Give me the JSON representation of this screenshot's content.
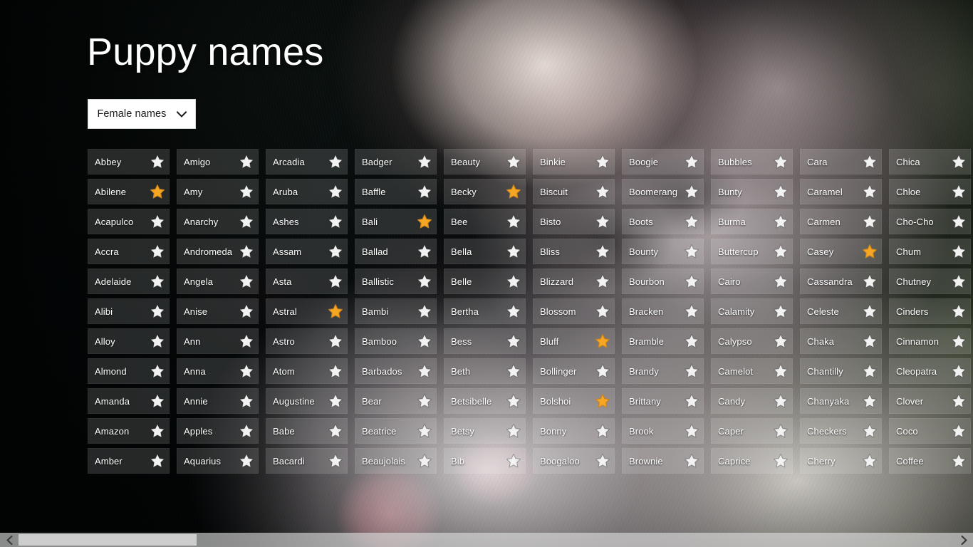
{
  "app": {
    "title": "Puppy names"
  },
  "filter": {
    "label": "Female names",
    "icon": "chevron-down-icon"
  },
  "scrollbar": {
    "left_arrow_icon": "chevron-left-icon",
    "right_arrow_icon": "chevron-right-icon",
    "thumb_position_percent": 0,
    "thumb_width_percent": 19
  },
  "colors": {
    "star_filled": "#f5a623",
    "star_empty": "#f2f2f2",
    "tile_overlay": "rgba(255,255,255,0.14)",
    "button_background": "#ffffff",
    "button_text": "#1b1b1b",
    "title_text": "#ffffff"
  },
  "grid": {
    "columns": [
      {
        "index": 0,
        "items": [
          {
            "name": "Abbey",
            "favorite": false
          },
          {
            "name": "Abilene",
            "favorite": true
          },
          {
            "name": "Acapulco",
            "favorite": false
          },
          {
            "name": "Accra",
            "favorite": false
          },
          {
            "name": "Adelaide",
            "favorite": false
          },
          {
            "name": "Alibi",
            "favorite": false
          },
          {
            "name": "Alloy",
            "favorite": false
          },
          {
            "name": "Almond",
            "favorite": false
          },
          {
            "name": "Amanda",
            "favorite": false
          },
          {
            "name": "Amazon",
            "favorite": false
          },
          {
            "name": "Amber",
            "favorite": false
          }
        ]
      },
      {
        "index": 1,
        "items": [
          {
            "name": "Amigo",
            "favorite": false
          },
          {
            "name": "Amy",
            "favorite": false
          },
          {
            "name": "Anarchy",
            "favorite": false
          },
          {
            "name": "Andromeda",
            "favorite": false
          },
          {
            "name": "Angela",
            "favorite": false
          },
          {
            "name": "Anise",
            "favorite": false
          },
          {
            "name": "Ann",
            "favorite": false
          },
          {
            "name": "Anna",
            "favorite": false
          },
          {
            "name": "Annie",
            "favorite": false
          },
          {
            "name": "Apples",
            "favorite": false
          },
          {
            "name": "Aquarius",
            "favorite": false
          }
        ]
      },
      {
        "index": 2,
        "items": [
          {
            "name": "Arcadia",
            "favorite": false
          },
          {
            "name": "Aruba",
            "favorite": false
          },
          {
            "name": "Ashes",
            "favorite": false
          },
          {
            "name": "Assam",
            "favorite": false
          },
          {
            "name": "Asta",
            "favorite": false
          },
          {
            "name": "Astral",
            "favorite": true
          },
          {
            "name": "Astro",
            "favorite": false
          },
          {
            "name": "Atom",
            "favorite": false
          },
          {
            "name": "Augustine",
            "favorite": false
          },
          {
            "name": "Babe",
            "favorite": false
          },
          {
            "name": "Bacardi",
            "favorite": false
          }
        ]
      },
      {
        "index": 3,
        "items": [
          {
            "name": "Badger",
            "favorite": false
          },
          {
            "name": "Baffle",
            "favorite": false
          },
          {
            "name": "Bali",
            "favorite": true
          },
          {
            "name": "Ballad",
            "favorite": false
          },
          {
            "name": "Ballistic",
            "favorite": false
          },
          {
            "name": "Bambi",
            "favorite": false
          },
          {
            "name": "Bamboo",
            "favorite": false
          },
          {
            "name": "Barbados",
            "favorite": false
          },
          {
            "name": "Bear",
            "favorite": false
          },
          {
            "name": "Beatrice",
            "favorite": false
          },
          {
            "name": "Beaujolais",
            "favorite": false
          }
        ]
      },
      {
        "index": 4,
        "items": [
          {
            "name": "Beauty",
            "favorite": false
          },
          {
            "name": "Becky",
            "favorite": true
          },
          {
            "name": "Bee",
            "favorite": false
          },
          {
            "name": "Bella",
            "favorite": false
          },
          {
            "name": "Belle",
            "favorite": false
          },
          {
            "name": "Bertha",
            "favorite": false
          },
          {
            "name": "Bess",
            "favorite": false
          },
          {
            "name": "Beth",
            "favorite": false
          },
          {
            "name": "Betsibelle",
            "favorite": false
          },
          {
            "name": "Betsy",
            "favorite": false
          },
          {
            "name": "Bib",
            "favorite": false
          }
        ]
      },
      {
        "index": 5,
        "items": [
          {
            "name": "Binkie",
            "favorite": false
          },
          {
            "name": "Biscuit",
            "favorite": false
          },
          {
            "name": "Bisto",
            "favorite": false
          },
          {
            "name": "Bliss",
            "favorite": false
          },
          {
            "name": "Blizzard",
            "favorite": false
          },
          {
            "name": "Blossom",
            "favorite": false
          },
          {
            "name": "Bluff",
            "favorite": true
          },
          {
            "name": "Bollinger",
            "favorite": false
          },
          {
            "name": "Bolshoi",
            "favorite": true
          },
          {
            "name": "Bonny",
            "favorite": false
          },
          {
            "name": "Boogaloo",
            "favorite": false
          }
        ]
      },
      {
        "index": 6,
        "items": [
          {
            "name": "Boogie",
            "favorite": false
          },
          {
            "name": "Boomerang",
            "favorite": false
          },
          {
            "name": "Boots",
            "favorite": false
          },
          {
            "name": "Bounty",
            "favorite": false
          },
          {
            "name": "Bourbon",
            "favorite": false
          },
          {
            "name": "Bracken",
            "favorite": false
          },
          {
            "name": "Bramble",
            "favorite": false
          },
          {
            "name": "Brandy",
            "favorite": false
          },
          {
            "name": "Brittany",
            "favorite": false
          },
          {
            "name": "Brook",
            "favorite": false
          },
          {
            "name": "Brownie",
            "favorite": false
          }
        ]
      },
      {
        "index": 7,
        "items": [
          {
            "name": "Bubbles",
            "favorite": false
          },
          {
            "name": "Bunty",
            "favorite": false
          },
          {
            "name": "Burma",
            "favorite": false
          },
          {
            "name": "Buttercup",
            "favorite": false
          },
          {
            "name": "Cairo",
            "favorite": false
          },
          {
            "name": "Calamity",
            "favorite": false
          },
          {
            "name": "Calypso",
            "favorite": false
          },
          {
            "name": "Camelot",
            "favorite": false
          },
          {
            "name": "Candy",
            "favorite": false
          },
          {
            "name": "Caper",
            "favorite": false
          },
          {
            "name": "Caprice",
            "favorite": false
          }
        ]
      },
      {
        "index": 8,
        "items": [
          {
            "name": "Cara",
            "favorite": false
          },
          {
            "name": "Caramel",
            "favorite": false
          },
          {
            "name": "Carmen",
            "favorite": false
          },
          {
            "name": "Casey",
            "favorite": true
          },
          {
            "name": "Cassandra",
            "favorite": false
          },
          {
            "name": "Celeste",
            "favorite": false
          },
          {
            "name": "Chaka",
            "favorite": false
          },
          {
            "name": "Chantilly",
            "favorite": false
          },
          {
            "name": "Chanyaka",
            "favorite": false
          },
          {
            "name": "Checkers",
            "favorite": false
          },
          {
            "name": "Cherry",
            "favorite": false
          }
        ]
      },
      {
        "index": 9,
        "items": [
          {
            "name": "Chica",
            "favorite": false
          },
          {
            "name": "Chloe",
            "favorite": false
          },
          {
            "name": "Cho-Cho",
            "favorite": false
          },
          {
            "name": "Chum",
            "favorite": false
          },
          {
            "name": "Chutney",
            "favorite": false
          },
          {
            "name": "Cinders",
            "favorite": false
          },
          {
            "name": "Cinnamon",
            "favorite": false
          },
          {
            "name": "Cleopatra",
            "favorite": false
          },
          {
            "name": "Clover",
            "favorite": false
          },
          {
            "name": "Coco",
            "favorite": false
          },
          {
            "name": "Coffee",
            "favorite": false
          }
        ]
      }
    ]
  }
}
